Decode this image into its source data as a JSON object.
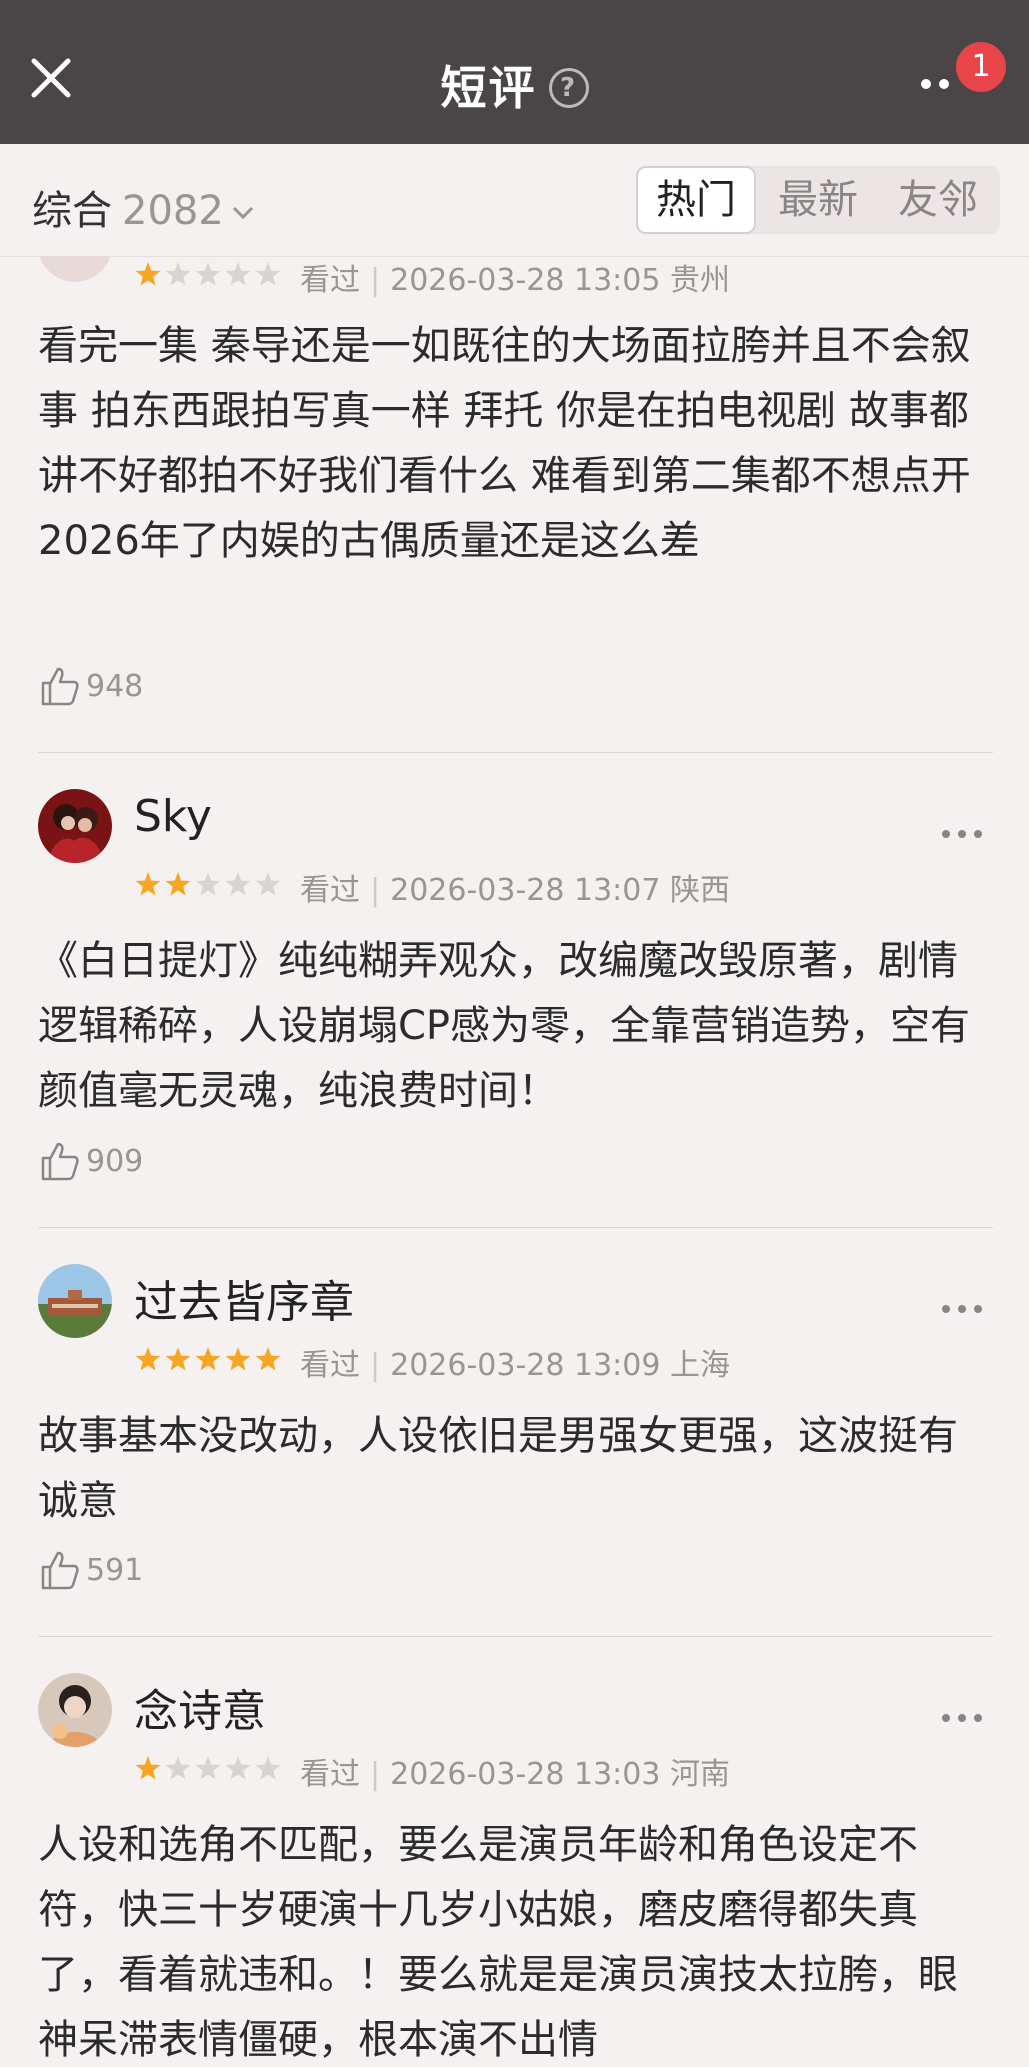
{
  "header": {
    "title": "短评",
    "help_symbol": "?",
    "notification_count": "1"
  },
  "filter": {
    "sort_label": "综合",
    "count": "2082",
    "tabs": [
      {
        "label": "热门",
        "active": true
      },
      {
        "label": "最新",
        "active": false
      },
      {
        "label": "友邻",
        "active": false
      }
    ]
  },
  "reviews": [
    {
      "username": "",
      "rating": 1,
      "status": "看过",
      "datetime": "2026-03-28 13:05",
      "location": "贵州",
      "text": "看完一集 秦导还是一如既往的大场面拉胯并且不会叙事 拍东西跟拍写真一样 拜托 你是在拍电视剧 故事都讲不好都拍不好我们看什么 难看到第二集都不想点开 2026年了内娱的古偶质量还是这么差",
      "likes": "948"
    },
    {
      "username": "Sky",
      "rating": 2,
      "status": "看过",
      "datetime": "2026-03-28 13:07",
      "location": "陕西",
      "text": "《白日提灯》纯纯糊弄观众，改编魔改毁原著，剧情逻辑稀碎，人设崩塌CP感为零，全靠营销造势，空有颜值毫无灵魂，纯浪费时间！",
      "likes": "909"
    },
    {
      "username": "过去皆序章",
      "rating": 5,
      "status": "看过",
      "datetime": "2026-03-28 13:09",
      "location": "上海",
      "text": "故事基本没改动，人设依旧是男强女更强，这波挺有诚意",
      "likes": "591"
    },
    {
      "username": "念诗意",
      "rating": 1,
      "status": "看过",
      "datetime": "2026-03-28 13:03",
      "location": "河南",
      "text": "人设和选角不匹配，要么是演员年龄和角色设定不符，快三十岁硬演十几岁小姑娘，磨皮磨得都失真了，看着就违和。！要么就是是演员演技太拉胯，眼神呆滞表情僵硬，根本演不出情",
      "likes": ""
    }
  ],
  "colors": {
    "topbar": "#4a4546",
    "star_on": "#f5a623",
    "star_off": "#d9d3d3",
    "badge": "#e8454a"
  }
}
